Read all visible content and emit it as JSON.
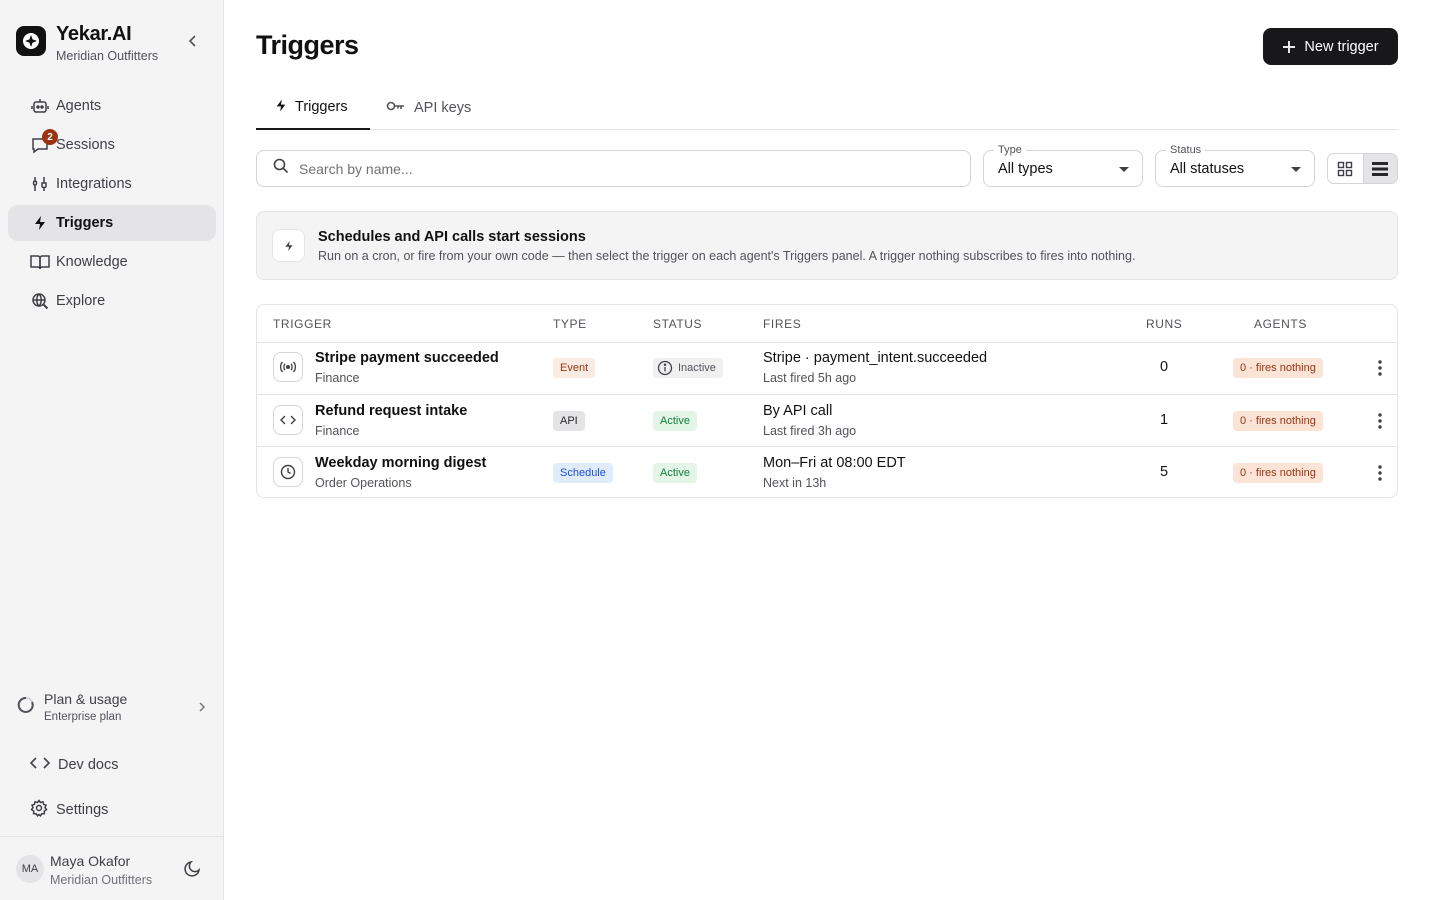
{
  "brand": {
    "name": "Yekar.AI",
    "org": "Meridian Outfitters"
  },
  "sidebar": {
    "items": [
      {
        "label": "Agents",
        "icon": "robot-icon"
      },
      {
        "label": "Sessions",
        "icon": "chat-bubble-icon",
        "badge": "2"
      },
      {
        "label": "Integrations",
        "icon": "plug-icon"
      },
      {
        "label": "Triggers",
        "icon": "lightning-bolt-icon",
        "active": true
      },
      {
        "label": "Knowledge",
        "icon": "book-icon"
      },
      {
        "label": "Explore",
        "icon": "search-globe-icon"
      }
    ],
    "plan": {
      "title": "Plan & usage",
      "subtitle": "Enterprise plan"
    },
    "dev_docs": "Dev docs",
    "settings": "Settings",
    "user": {
      "initials": "MA",
      "name": "Maya Okafor",
      "org": "Meridian Outfitters"
    }
  },
  "header": {
    "title": "Triggers",
    "new_button": "New trigger"
  },
  "tabs": [
    {
      "label": "Triggers",
      "active": true
    },
    {
      "label": "API keys",
      "active": false
    }
  ],
  "filters": {
    "search_placeholder": "Search by name...",
    "type": {
      "label": "Type",
      "value": "All types"
    },
    "status": {
      "label": "Status",
      "value": "All statuses"
    }
  },
  "banner": {
    "title": "Schedules and API calls start sessions",
    "text": "Run on a cron, or fire from your own code — then select the trigger on each agent's Triggers panel. A trigger nothing subscribes to fires into nothing."
  },
  "table": {
    "columns": [
      "TRIGGER",
      "TYPE",
      "STATUS",
      "FIRES",
      "RUNS",
      "AGENTS"
    ],
    "rows": [
      {
        "name": "Stripe payment succeeded",
        "group": "Finance",
        "type": "Event",
        "status": "Inactive",
        "fires": "Stripe · payment_intent.succeeded",
        "fires_sub": "Last fired 5h ago",
        "runs": "0",
        "agents": "0 · fires nothing",
        "icon": "broadcast-icon"
      },
      {
        "name": "Refund request intake",
        "group": "Finance",
        "type": "API",
        "status": "Active",
        "fires": "By API call",
        "fires_sub": "Last fired 3h ago",
        "runs": "1",
        "agents": "0 · fires nothing",
        "icon": "code-brackets-icon"
      },
      {
        "name": "Weekday morning digest",
        "group": "Order Operations",
        "type": "Schedule",
        "status": "Active",
        "fires": "Mon–Fri at 08:00 EDT",
        "fires_sub": "Next in 13h",
        "runs": "5",
        "agents": "0 · fires nothing",
        "icon": "clock-icon"
      }
    ]
  },
  "colors": {
    "primary": "#18181b",
    "sidebar_bg": "#f4f4f5",
    "badge": "#9a3412",
    "active_green": "#15803d",
    "schedule_blue": "#1d4ed8"
  }
}
